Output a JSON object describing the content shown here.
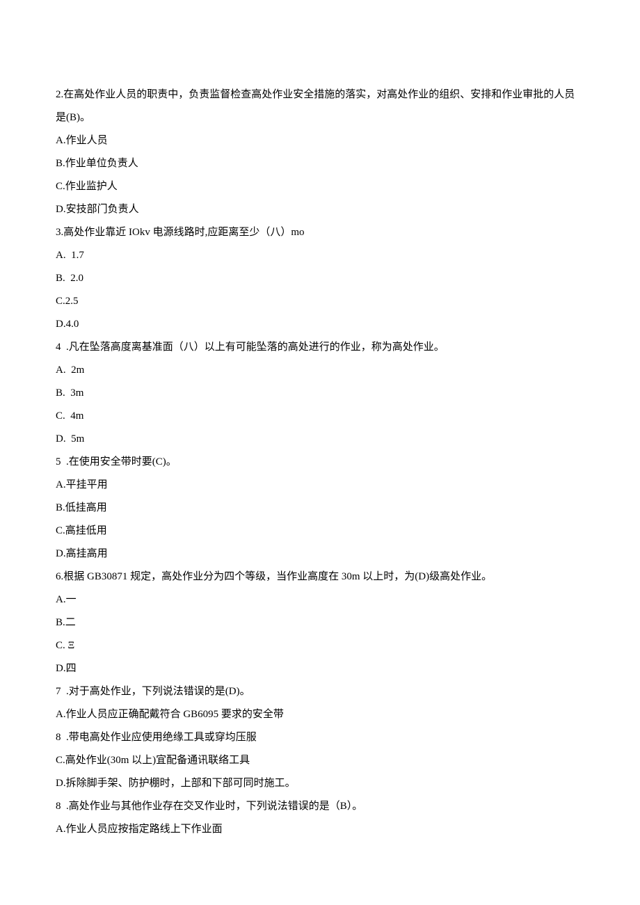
{
  "lines": [
    "2.在高处作业人员的职责中，负责监督检查高处作业安全措施的落实，对高处作业的组织、安排和作业审批的人员是(B)。",
    "A.作业人员",
    "B.作业单位负责人",
    "C.作业监护人",
    "D.安技部门负责人",
    "3.高处作业靠近 IOkv 电源线路时,应距离至少（八）mo",
    "A.  1.7",
    "B.  2.0",
    "C.2.5",
    "D.4.0",
    "4  .凡在坠落高度离基准面（八）以上有可能坠落的高处进行的作业，称为高处作业。",
    "A.  2m",
    "B.  3m",
    "C.  4m",
    "D.  5m",
    "5  .在使用安全带时要(C)。",
    "A.平挂平用",
    "B.低挂高用",
    "C.高挂低用",
    "D.高挂高用",
    "6.根据 GB30871 规定，高处作业分为四个等级，当作业高度在 30m 以上时，为(D)级高处作业。",
    "A.一",
    "B.二",
    "C. Ξ",
    "D.四",
    "7  .对于高处作业，下列说法错误的是(D)。",
    "A.作业人员应正确配戴符合 GB6095 要求的安全带",
    "8  .带电高处作业应使用绝缘工具或穿均压服",
    "C.高处作业(30m 以上)宜配备通讯联络工具",
    "D.拆除脚手架、防护棚时，上部和下部可同时施工。",
    "8  .高处作业与其他作业存在交叉作业时，下列说法错误的是（B）。",
    "A.作业人员应按指定路线上下作业面"
  ]
}
